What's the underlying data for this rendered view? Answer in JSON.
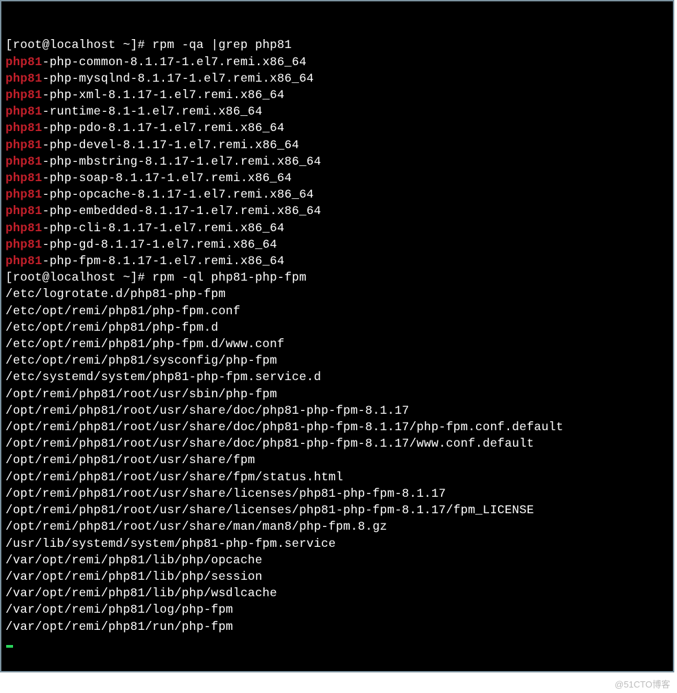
{
  "terminal": {
    "prompt": "[root@localhost ~]# ",
    "cmd1": "rpm -qa |grep php81",
    "packages": [
      {
        "match": "php81",
        "rest": "-php-common-8.1.17-1.el7.remi.x86_64"
      },
      {
        "match": "php81",
        "rest": "-php-mysqlnd-8.1.17-1.el7.remi.x86_64"
      },
      {
        "match": "php81",
        "rest": "-php-xml-8.1.17-1.el7.remi.x86_64"
      },
      {
        "match": "php81",
        "rest": "-runtime-8.1-1.el7.remi.x86_64"
      },
      {
        "match": "php81",
        "rest": "-php-pdo-8.1.17-1.el7.remi.x86_64"
      },
      {
        "match": "php81",
        "rest": "-php-devel-8.1.17-1.el7.remi.x86_64"
      },
      {
        "match": "php81",
        "rest": "-php-mbstring-8.1.17-1.el7.remi.x86_64"
      },
      {
        "match": "php81",
        "rest": "-php-soap-8.1.17-1.el7.remi.x86_64"
      },
      {
        "match": "php81",
        "rest": "-php-opcache-8.1.17-1.el7.remi.x86_64"
      },
      {
        "match": "php81",
        "rest": "-php-embedded-8.1.17-1.el7.remi.x86_64"
      },
      {
        "match": "php81",
        "rest": "-php-cli-8.1.17-1.el7.remi.x86_64"
      },
      {
        "match": "php81",
        "rest": "-php-gd-8.1.17-1.el7.remi.x86_64"
      },
      {
        "match": "php81",
        "rest": "-php-fpm-8.1.17-1.el7.remi.x86_64"
      }
    ],
    "cmd2": "rpm -ql php81-php-fpm",
    "files": [
      "/etc/logrotate.d/php81-php-fpm",
      "/etc/opt/remi/php81/php-fpm.conf",
      "/etc/opt/remi/php81/php-fpm.d",
      "/etc/opt/remi/php81/php-fpm.d/www.conf",
      "/etc/opt/remi/php81/sysconfig/php-fpm",
      "/etc/systemd/system/php81-php-fpm.service.d",
      "/opt/remi/php81/root/usr/sbin/php-fpm",
      "/opt/remi/php81/root/usr/share/doc/php81-php-fpm-8.1.17",
      "/opt/remi/php81/root/usr/share/doc/php81-php-fpm-8.1.17/php-fpm.conf.default",
      "/opt/remi/php81/root/usr/share/doc/php81-php-fpm-8.1.17/www.conf.default",
      "/opt/remi/php81/root/usr/share/fpm",
      "/opt/remi/php81/root/usr/share/fpm/status.html",
      "/opt/remi/php81/root/usr/share/licenses/php81-php-fpm-8.1.17",
      "/opt/remi/php81/root/usr/share/licenses/php81-php-fpm-8.1.17/fpm_LICENSE",
      "/opt/remi/php81/root/usr/share/man/man8/php-fpm.8.gz",
      "/usr/lib/systemd/system/php81-php-fpm.service",
      "/var/opt/remi/php81/lib/php/opcache",
      "/var/opt/remi/php81/lib/php/session",
      "/var/opt/remi/php81/lib/php/wsdlcache",
      "/var/opt/remi/php81/log/php-fpm",
      "/var/opt/remi/php81/run/php-fpm"
    ]
  },
  "watermark": "@51CTO博客"
}
